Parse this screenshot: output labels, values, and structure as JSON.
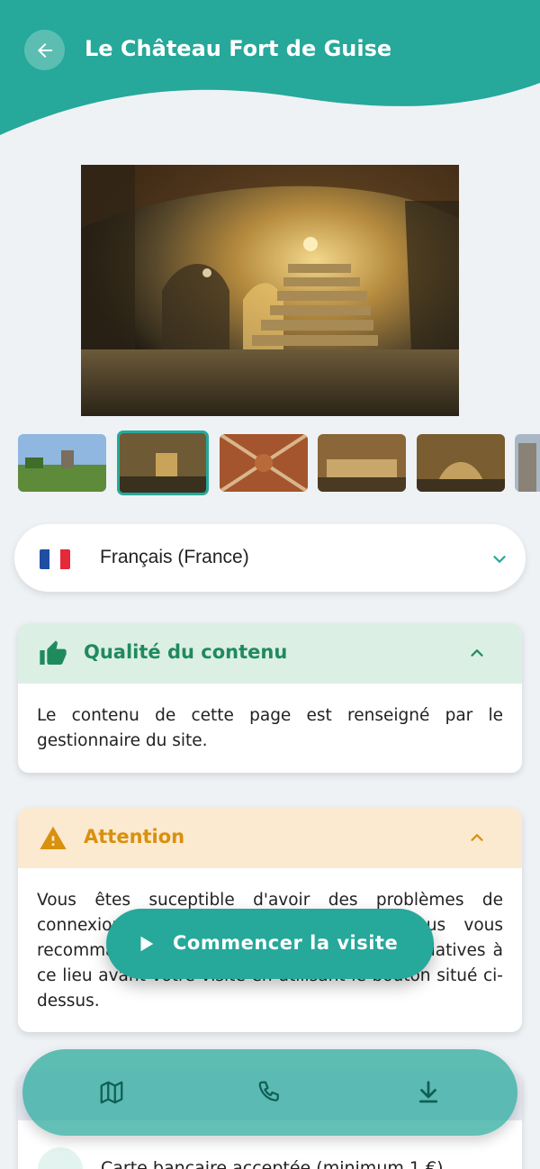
{
  "header": {
    "title": "Le Château Fort de Guise",
    "back_icon": "arrow-left-icon"
  },
  "colors": {
    "accent": "#26a89a",
    "quality": "#1f8a5e",
    "warning": "#d9900d"
  },
  "language": {
    "selected": "Français (France)",
    "flag_icon": "flag-france-icon"
  },
  "quality_card": {
    "title": "Qualité du contenu",
    "body": "Le contenu de cette page est renseigné par le gestionnaire du site."
  },
  "warning_card": {
    "title": "Attention",
    "body": "Vous êtes suceptible d'avoir des problèmes de connexion au réseau dans ce lieu. Nous vous recommandons de télécharger les données relatives à ce lieu avant votre visite en utilisant le bouton situé ci-dessus."
  },
  "payment": {
    "label": "Carte bancaire acceptée (minimum 1 €)"
  },
  "start_button": {
    "label": "Commencer la visite"
  },
  "bottom_nav": [
    {
      "icon": "map-icon"
    },
    {
      "icon": "phone-icon"
    },
    {
      "icon": "download-icon"
    }
  ]
}
